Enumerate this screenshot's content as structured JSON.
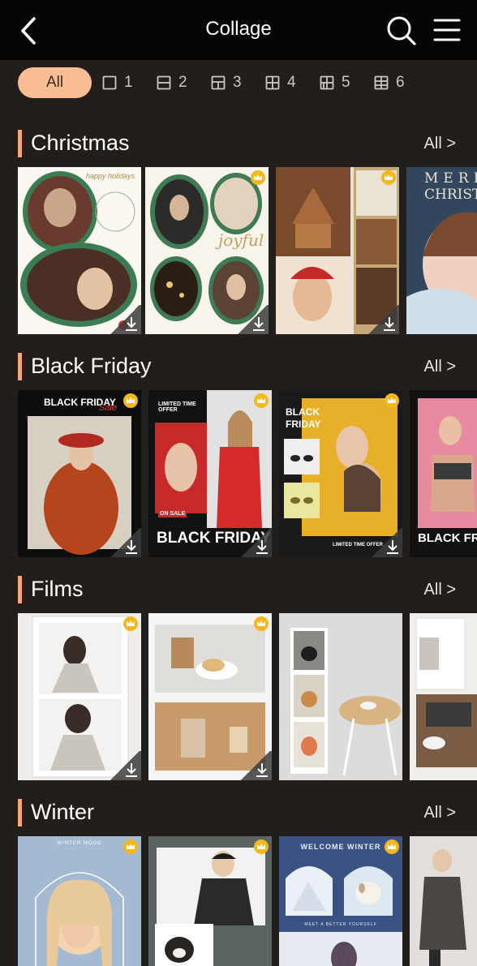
{
  "header": {
    "title": "Collage"
  },
  "filters": [
    {
      "label": "All"
    },
    {
      "label": "1"
    },
    {
      "label": "2"
    },
    {
      "label": "3"
    },
    {
      "label": "4"
    },
    {
      "label": "5"
    },
    {
      "label": "6"
    }
  ],
  "sections": [
    {
      "title": "Christmas",
      "all_label": "All >",
      "cards": [
        {
          "texts": [
            "happy holidays"
          ]
        },
        {
          "texts": [
            "joyful"
          ]
        },
        {
          "texts": []
        },
        {
          "texts": [
            "MERRY",
            "CHRISTM"
          ]
        }
      ]
    },
    {
      "title": "Black Friday",
      "all_label": "All >",
      "cards": [
        {
          "texts": [
            "BLACK FRIDAY",
            "Sale"
          ]
        },
        {
          "texts": [
            "LIMITED TIME OFFER",
            "ON SALE",
            "BLACK FRIDAY"
          ]
        },
        {
          "texts": [
            "BLACK FRIDAY",
            "LIMITED TIME OFFER"
          ]
        },
        {
          "texts": [
            "BLACK FRI"
          ]
        }
      ]
    },
    {
      "title": "Films",
      "all_label": "All >",
      "cards": [
        {
          "texts": []
        },
        {
          "texts": []
        },
        {
          "texts": []
        },
        {
          "texts": []
        }
      ]
    },
    {
      "title": "Winter",
      "all_label": "All >",
      "cards": [
        {
          "texts": [
            "WINTER MOOD"
          ]
        },
        {
          "texts": []
        },
        {
          "texts": [
            "WELCOME WINTER",
            "MEET A BETTER YOURSELF"
          ]
        },
        {
          "texts": []
        }
      ]
    }
  ]
}
